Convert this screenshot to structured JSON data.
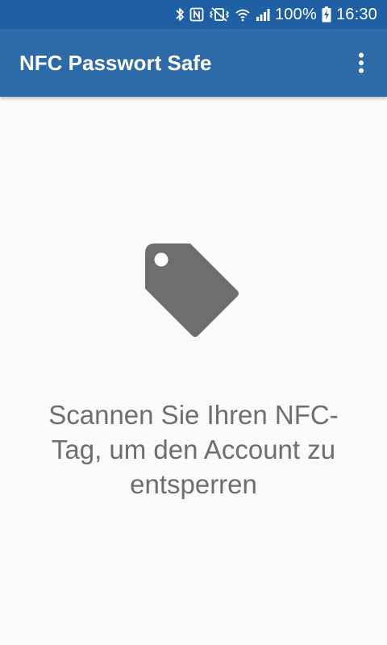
{
  "status_bar": {
    "battery": "100%",
    "time": "16:30",
    "icons": [
      "bluetooth-icon",
      "nfc-icon",
      "vibrate-icon",
      "wifi-icon",
      "signal-icon",
      "battery-charging-icon"
    ]
  },
  "app_bar": {
    "title": "NFC Passwort Safe",
    "menu_icon": "more-vert-icon"
  },
  "main": {
    "icon": "tag-icon",
    "message": "Scannen Sie Ihren NFC-Tag, um den Account zu entsperren"
  },
  "colors": {
    "status_bar": "#1f5fa3",
    "app_bar": "#2d6aa8",
    "background": "#fafafa",
    "icon": "#6e6e6e",
    "text": "#6e6e6e"
  }
}
